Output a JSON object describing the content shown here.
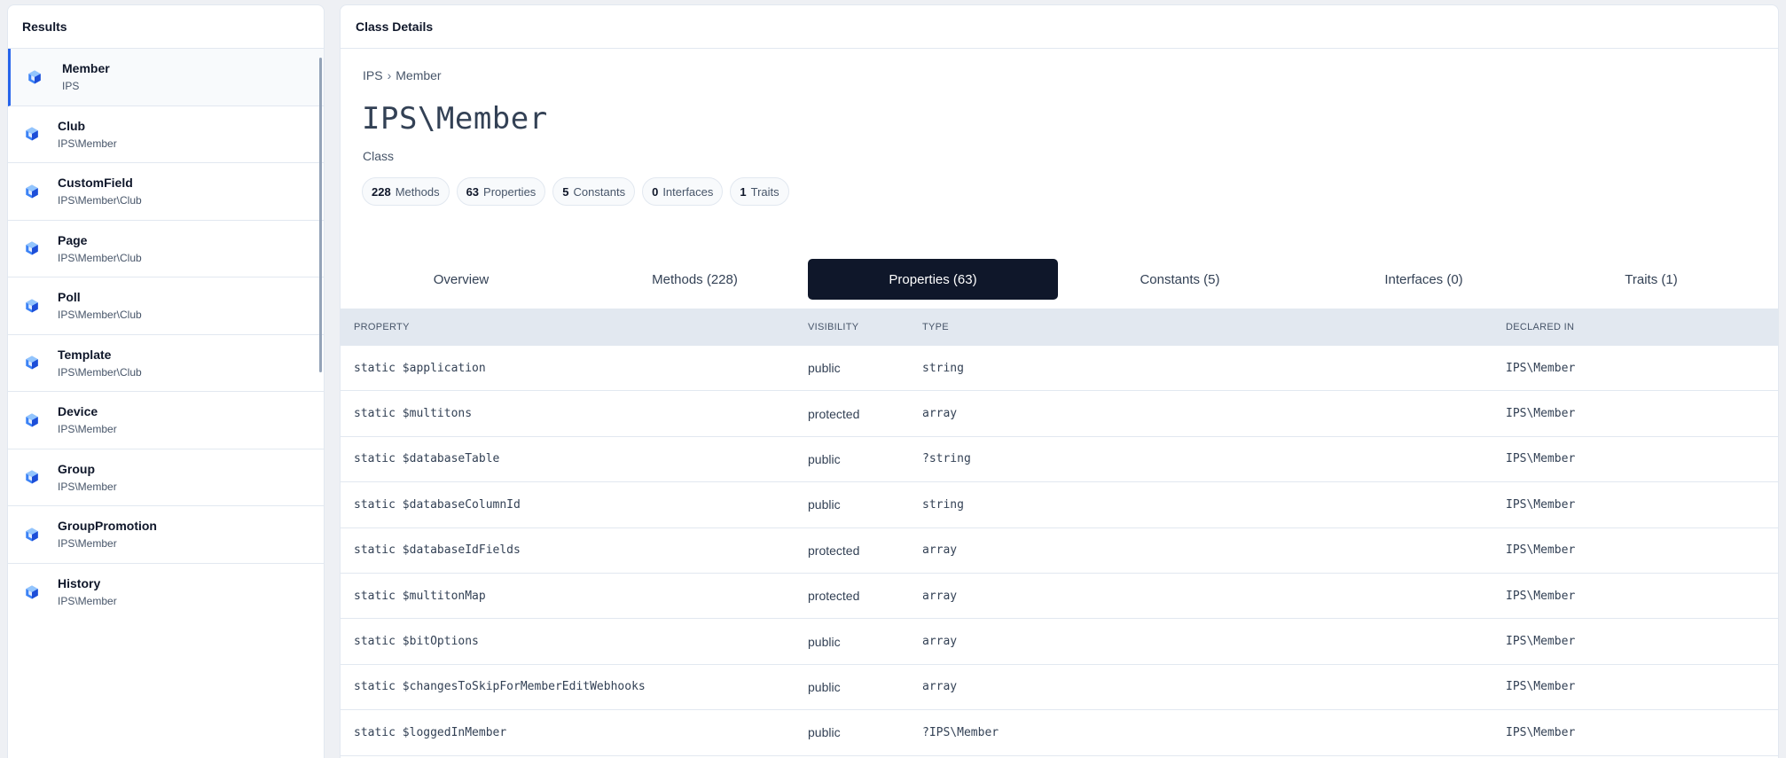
{
  "left_panel": {
    "title": "Results",
    "items": [
      {
        "title": "Member",
        "sub": "IPS"
      },
      {
        "title": "Club",
        "sub": "IPS\\Member"
      },
      {
        "title": "CustomField",
        "sub": "IPS\\Member\\Club"
      },
      {
        "title": "Page",
        "sub": "IPS\\Member\\Club"
      },
      {
        "title": "Poll",
        "sub": "IPS\\Member\\Club"
      },
      {
        "title": "Template",
        "sub": "IPS\\Member\\Club"
      },
      {
        "title": "Device",
        "sub": "IPS\\Member"
      },
      {
        "title": "Group",
        "sub": "IPS\\Member"
      },
      {
        "title": "GroupPromotion",
        "sub": "IPS\\Member"
      },
      {
        "title": "History",
        "sub": "IPS\\Member"
      }
    ]
  },
  "right_panel": {
    "title": "Class Details",
    "breadcrumb": {
      "root": "IPS",
      "sep": "›",
      "leaf": "Member"
    },
    "class_name": "IPS\\Member",
    "kind": "Class",
    "badges": [
      {
        "count": "228",
        "label": "Methods"
      },
      {
        "count": "63",
        "label": "Properties"
      },
      {
        "count": "5",
        "label": "Constants"
      },
      {
        "count": "0",
        "label": "Interfaces"
      },
      {
        "count": "1",
        "label": "Traits"
      }
    ],
    "tabs": [
      {
        "label": "Overview"
      },
      {
        "label": "Methods (228)"
      },
      {
        "label": "Properties (63)"
      },
      {
        "label": "Constants (5)"
      },
      {
        "label": "Interfaces (0)"
      },
      {
        "label": "Traits (1)"
      }
    ],
    "active_tab": "Properties (63)",
    "table": {
      "headers": [
        "PROPERTY",
        "VISIBILITY",
        "TYPE",
        "DECLARED IN"
      ],
      "rows": [
        {
          "property": "static $application",
          "visibility": "public",
          "type": "string",
          "declared": "IPS\\Member"
        },
        {
          "property": "static $multitons",
          "visibility": "protected",
          "type": "array",
          "declared": "IPS\\Member"
        },
        {
          "property": "static $databaseTable",
          "visibility": "public",
          "type": "?string",
          "declared": "IPS\\Member"
        },
        {
          "property": "static $databaseColumnId",
          "visibility": "public",
          "type": "string",
          "declared": "IPS\\Member"
        },
        {
          "property": "static $databaseIdFields",
          "visibility": "protected",
          "type": "array",
          "declared": "IPS\\Member"
        },
        {
          "property": "static $multitonMap",
          "visibility": "protected",
          "type": "array",
          "declared": "IPS\\Member"
        },
        {
          "property": "static $bitOptions",
          "visibility": "public",
          "type": "array",
          "declared": "IPS\\Member"
        },
        {
          "property": "static $changesToSkipForMemberEditWebhooks",
          "visibility": "public",
          "type": "array",
          "declared": "IPS\\Member"
        },
        {
          "property": "static $loggedInMember",
          "visibility": "public",
          "type": "?IPS\\Member",
          "declared": "IPS\\Member"
        }
      ]
    }
  },
  "colors": {
    "accent": "#2563eb",
    "active_tab_bg": "#0f172a",
    "table_header_bg": "#e2e8f0"
  },
  "icons": {
    "result_item": "cube-icon"
  }
}
